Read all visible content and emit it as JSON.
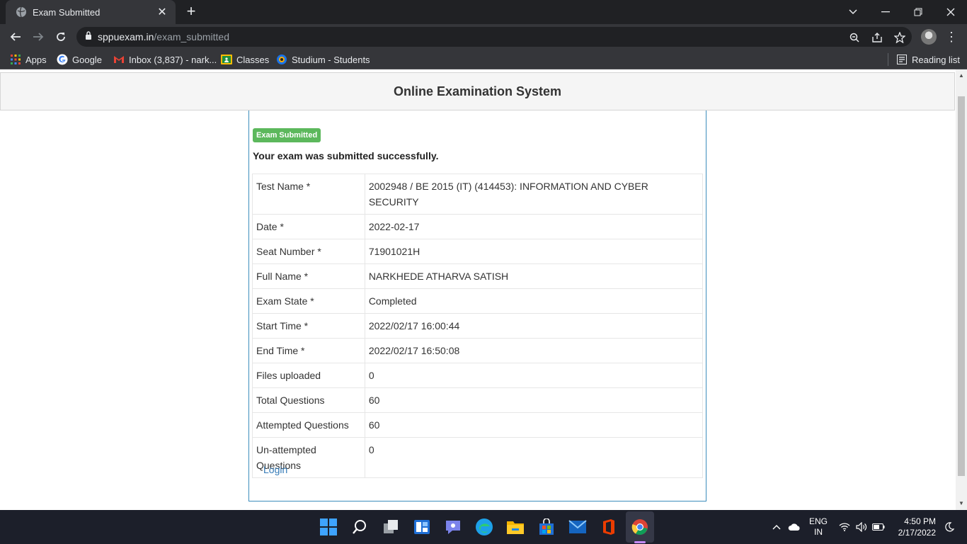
{
  "browser": {
    "tab_title": "Exam Submitted",
    "url_host": "sppuexam.in",
    "url_path": "/exam_submitted",
    "bookmarks": [
      {
        "label": "Apps",
        "icon": "apps-grid-icon"
      },
      {
        "label": "Google",
        "icon": "google-icon"
      },
      {
        "label": "Inbox (3,837) - nark...",
        "icon": "gmail-icon"
      },
      {
        "label": "Classes",
        "icon": "classroom-icon"
      },
      {
        "label": "Studium - Students",
        "icon": "studium-icon"
      }
    ],
    "reading_list_label": "Reading list"
  },
  "page": {
    "header_title": "Online Examination System",
    "badge_label": "Exam Submitted",
    "success_message": "Your exam was submitted successfully.",
    "details": [
      {
        "key": "Test Name *",
        "value": "2002948 / BE 2015 (IT) (414453): INFORMATION AND CYBER SECURITY"
      },
      {
        "key": "Date *",
        "value": "2022-02-17"
      },
      {
        "key": "Seat Number *",
        "value": "71901021H"
      },
      {
        "key": "Full Name *",
        "value": "NARKHEDE ATHARVA SATISH"
      },
      {
        "key": "Exam State *",
        "value": "Completed"
      },
      {
        "key": "Start Time *",
        "value": "2022/02/17 16:00:44"
      },
      {
        "key": "End Time *",
        "value": "2022/02/17 16:50:08"
      },
      {
        "key": "Files uploaded",
        "value": "0"
      },
      {
        "key": "Total Questions",
        "value": "60"
      },
      {
        "key": "Attempted Questions",
        "value": "60"
      },
      {
        "key": "Un-attempted Questions",
        "value": "0"
      }
    ],
    "login_link": "Login",
    "colors": {
      "badge": "#5cb85c",
      "link": "#337ab7",
      "panel_border": "#3c8dbc"
    }
  },
  "taskbar": {
    "lang_line1": "ENG",
    "lang_line2": "IN",
    "time": "4:50 PM",
    "date": "2/17/2022"
  }
}
